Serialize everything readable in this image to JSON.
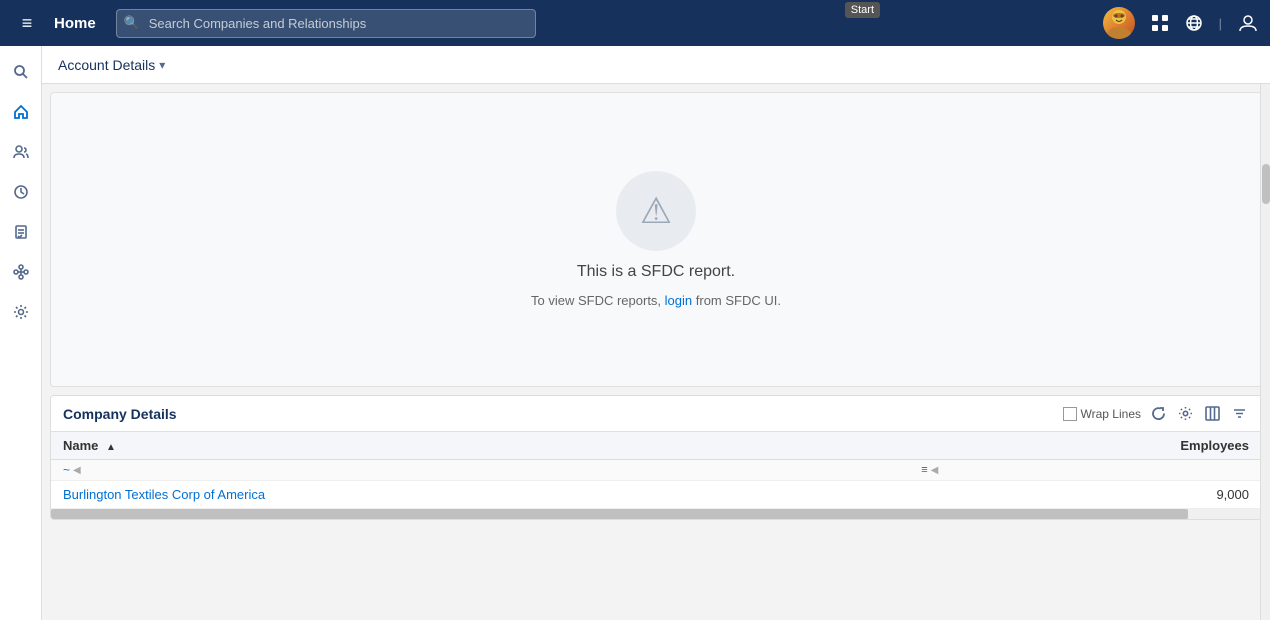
{
  "topnav": {
    "home_label": "Home",
    "search_placeholder": "Search Companies and Relationships",
    "start_tooltip": "Start"
  },
  "header": {
    "account_details_label": "Account Details"
  },
  "sidebar": {
    "items": [
      {
        "icon": "☰",
        "name": "menu",
        "active": false
      },
      {
        "icon": "🔍",
        "name": "search",
        "active": false
      },
      {
        "icon": "🏠",
        "name": "home",
        "active": true
      },
      {
        "icon": "👥",
        "name": "contacts",
        "active": false
      },
      {
        "icon": "🕐",
        "name": "recent",
        "active": false
      },
      {
        "icon": "✓",
        "name": "tasks",
        "active": false
      },
      {
        "icon": "🔗",
        "name": "relationships",
        "active": false
      },
      {
        "icon": "⚙",
        "name": "settings",
        "active": false
      }
    ]
  },
  "sfdc_panel": {
    "title": "This is a SFDC report.",
    "subtitle_pre": "To view SFDC reports, ",
    "login_link": "login",
    "subtitle_post": " from SFDC UI."
  },
  "company_details": {
    "title": "Company Details",
    "wrap_lines_label": "Wrap Lines",
    "columns": [
      {
        "label": "Name",
        "sort": "asc"
      },
      {
        "label": "Employees",
        "sort": null
      }
    ],
    "rows": [
      {
        "name": "Burlington Textiles Corp of America",
        "employees": "9,000"
      }
    ]
  },
  "icons": {
    "hamburger": "≡",
    "search": "🔍",
    "grid": "⊞",
    "globe": "⊙",
    "profile": "👤",
    "refresh": "↻",
    "gear": "⚙",
    "columns": "⊟",
    "filter": "⊿",
    "chevron_down": "▾",
    "sort_asc": "▲",
    "warning": "⚠"
  }
}
